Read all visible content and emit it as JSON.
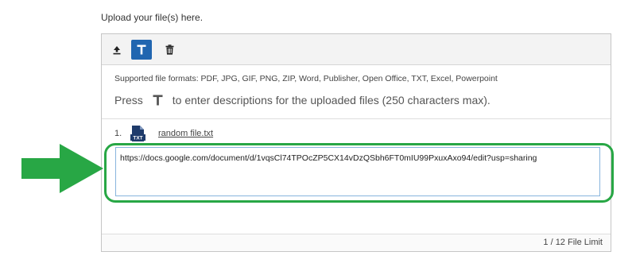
{
  "intro_text": "Upload your file(s) here.",
  "toolbar": {
    "upload_icon": "upload-icon",
    "text_icon": "text-T-icon",
    "delete_icon": "trash-icon",
    "active_color": "#2166b0"
  },
  "info": {
    "formats_text": "Supported file formats: PDF, JPG, GIF, PNG, ZIP, Word, Publisher, Open Office, TXT, Excel, Powerpoint",
    "press_before": "Press",
    "press_after": "to enter descriptions for the uploaded files (250 characters max)."
  },
  "files": [
    {
      "number": "1.",
      "type_label": "TXT",
      "name": "random file.txt",
      "description": "https://docs.google.com/document/d/1vqsCl74TPOcZP5CX14vDzQSbh6FT0mIU99PxuxAxo94/edit?usp=sharing"
    }
  ],
  "footer": {
    "limit_text": "1 / 12 File Limit"
  },
  "annotation": {
    "color": "#28a745"
  }
}
